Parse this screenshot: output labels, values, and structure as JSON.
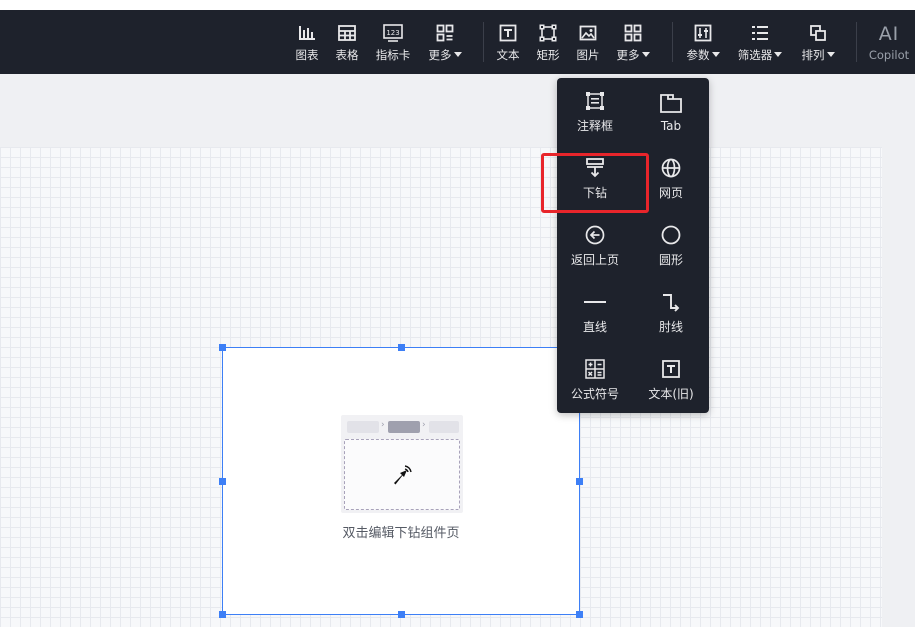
{
  "toolbar": {
    "chart": "图表",
    "table": "表格",
    "indicator_card": "指标卡",
    "more_1": "更多",
    "text": "文本",
    "rectangle": "矩形",
    "image": "图片",
    "more_2": "更多",
    "params": "参数",
    "filter": "筛选器",
    "arrange": "排列",
    "ai": "AI",
    "copilot": "Copilot"
  },
  "dropdown": {
    "items": [
      {
        "label": "注释框",
        "icon": "annotation-box-icon"
      },
      {
        "label": "Tab",
        "icon": "tab-icon"
      },
      {
        "label": "下钻",
        "icon": "drilldown-icon"
      },
      {
        "label": "网页",
        "icon": "globe-icon"
      },
      {
        "label": "返回上页",
        "icon": "back-circle-icon"
      },
      {
        "label": "圆形",
        "icon": "circle-icon"
      },
      {
        "label": "直线",
        "icon": "line-icon"
      },
      {
        "label": "肘线",
        "icon": "elbow-line-icon"
      },
      {
        "label": "公式符号",
        "icon": "formula-icon"
      },
      {
        "label": "文本(旧)",
        "icon": "text-old-icon"
      }
    ]
  },
  "widget": {
    "caption": "双击编辑下钻组件页"
  },
  "colors": {
    "toolbar_bg": "#1e222c",
    "selection": "#3d7ff6",
    "highlight": "#e8252b"
  }
}
